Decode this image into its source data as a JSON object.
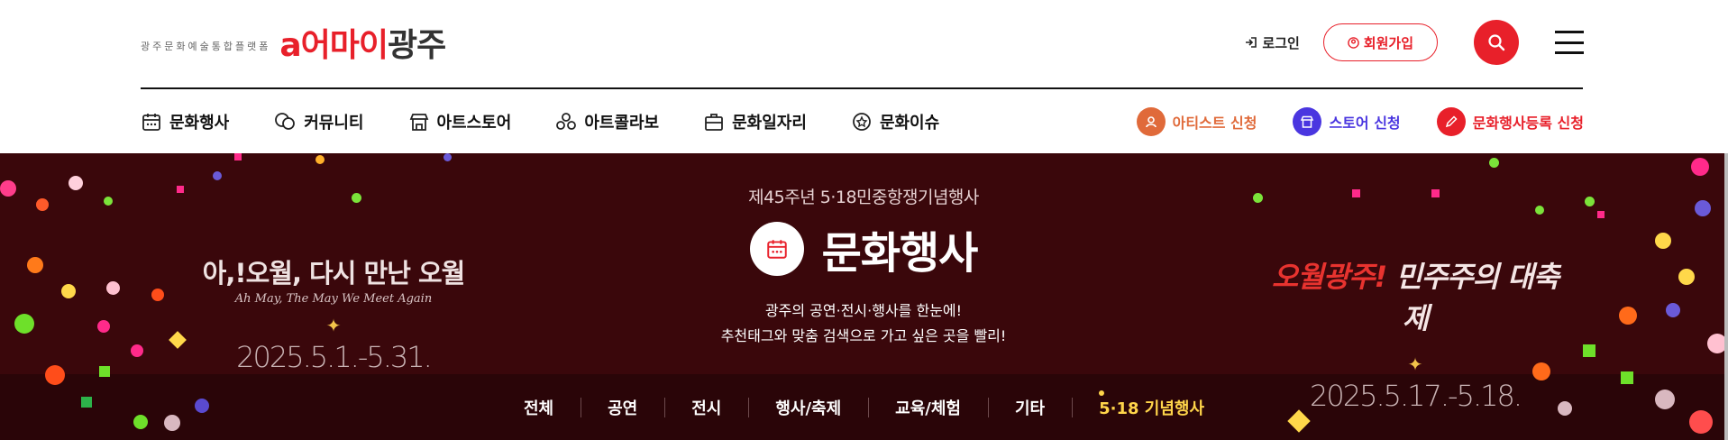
{
  "brand": {
    "tagline": "광주문화예술통합플랫폼",
    "logo_red": "a어마이",
    "logo_dark": "광주"
  },
  "util": {
    "login": "로그인",
    "join": "회원가입",
    "search_icon": "search-icon",
    "menu_icon": "hamburger-icon"
  },
  "gnb": {
    "items": [
      {
        "label": "문화행사",
        "icon": "calendar-icon"
      },
      {
        "label": "커뮤니티",
        "icon": "chat-icon"
      },
      {
        "label": "아트스토어",
        "icon": "store-icon"
      },
      {
        "label": "아트콜라보",
        "icon": "collab-icon"
      },
      {
        "label": "문화일자리",
        "icon": "briefcase-icon"
      },
      {
        "label": "문화이슈",
        "icon": "badge-icon"
      }
    ]
  },
  "apply": {
    "artist": "아티스트 신청",
    "store": "스토어 신청",
    "event": "문화행사등록 신청"
  },
  "hero": {
    "kicker": "제45주년 5·18민중항쟁기념행사",
    "title": "문화행사",
    "desc_line1": "광주의 공연·전시·행사를 한눈에!",
    "desc_line2": "추천태그와 맞춤 검색으로 가고 싶은 곳을 빨리!",
    "left_event": {
      "title": "아,!오월, 다시 만난 오월",
      "subtitle": "Ah May, The May We Meet Again",
      "date": "2025.5.1.-5.31."
    },
    "right_event": {
      "title_a": "오월광주!",
      "title_b": "민주주의 대축제",
      "date": "2025.5.17.-5.18."
    }
  },
  "tabs": [
    "전체",
    "공연",
    "전시",
    "행사/축제",
    "교육/체험",
    "기타",
    "5·18 기념행사"
  ],
  "colors": {
    "accent": "#e8202a",
    "hero_bg": "#3a070b",
    "active_tab": "#ffd54a",
    "artist": "#e06a3a",
    "store": "#4a36e0",
    "event": "#e8202a"
  }
}
